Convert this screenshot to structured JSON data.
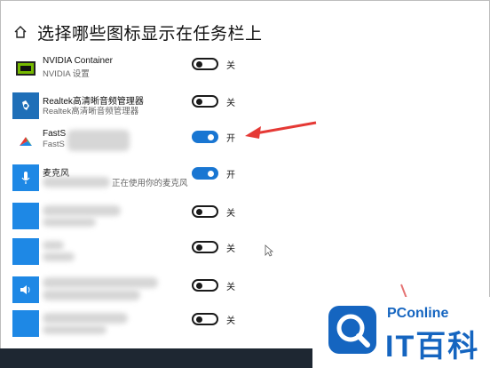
{
  "header": {
    "title": "选择哪些图标显示在任务栏上",
    "home_icon": "home-icon"
  },
  "rows": [
    {
      "name": "NVIDIA Container",
      "sub": "NVIDIA 设置",
      "state": "关",
      "on": false,
      "tile_color": "#ffffff",
      "icon": "nvidia-icon"
    },
    {
      "name": "Realtek高清晰音频管理器",
      "sub": "Realtek高清晰音频管理器",
      "state": "关",
      "on": false,
      "tile_color": "#1f6fb8",
      "icon": "realtek-audio-icon"
    },
    {
      "name": "FastS",
      "sub": "FastS",
      "state": "开",
      "on": true,
      "tile_color": "#ffffff",
      "icon": "faststone-icon"
    },
    {
      "name": "麦克风",
      "sub": "正在使用你的麦克风",
      "state": "开",
      "on": true,
      "tile_color": "#1e88e5",
      "icon": "microphone-icon"
    },
    {
      "name": "",
      "sub": "",
      "state": "关",
      "on": false,
      "tile_color": "#1e88e5",
      "icon": "app-icon"
    },
    {
      "name": "",
      "sub": "",
      "state": "关",
      "on": false,
      "tile_color": "#1e88e5",
      "icon": "app-icon"
    },
    {
      "name": "",
      "sub": "",
      "state": "关",
      "on": false,
      "tile_color": "#1e88e5",
      "icon": "speaker-icon"
    },
    {
      "name": "",
      "sub": "",
      "state": "关",
      "on": false,
      "tile_color": "#1e88e5",
      "icon": "app-icon"
    }
  ],
  "watermark": {
    "site": "PConline",
    "brand": "IT百科",
    "accent": "#1565c0"
  },
  "annotation": {
    "arrow_color": "#e53935"
  }
}
